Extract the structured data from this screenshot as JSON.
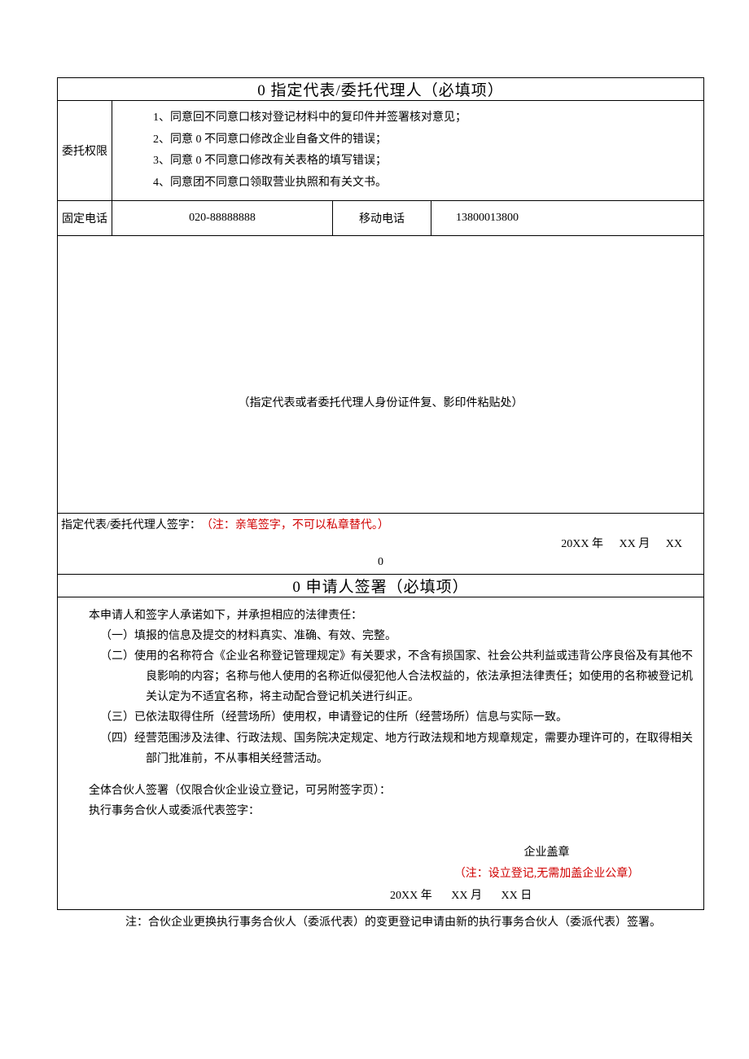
{
  "section1": {
    "title": "0 指定代表/委托代理人（必填项）",
    "auth_label": "委托权限",
    "auth_items": [
      "1、同意回不同意口核对登记材料中的复印件并签署核对意见；",
      "2、同意 0 不同意口修改企业自备文件的错误；",
      "3、同意 0 不同意口修改有关表格的填写错误；",
      "4、同意团不同意口领取营业执照和有关文书。"
    ],
    "fixed_phone_label": "固定电话",
    "fixed_phone_value": "020-88888888",
    "mobile_phone_label": "移动电话",
    "mobile_phone_value": "13800013800",
    "id_placeholder": "（指定代表或者委托代理人身份证件复、影印件粘贴处）",
    "sign_label": "指定代表/委托代理人签字：",
    "sign_note": "（注：亲笔签字，不可以私章替代。）",
    "date": {
      "year": "20XX 年",
      "month": "XX 月",
      "day": "XX"
    },
    "zero": "0"
  },
  "section2": {
    "title": "0 申请人签署（必填项）",
    "intro": "本申请人和签字人承诺如下，并承担相应的法律责任：",
    "items": [
      "（一）填报的信息及提交的材料真实、准确、有效、完整。",
      "（二）使用的名称符合《企业名称登记管理规定》有关要求，不含有损国家、社会公共利益或违背公序良俗及有其他不良影响的内容；名称与他人使用的名称近似侵犯他人合法权益的，依法承担法律责任；如使用的名称被登记机关认定为不适宜名称，将主动配合登记机关进行纠正。",
      "（三）已依法取得住所（经营场所）使用权，申请登记的住所（经营场所）信息与实际一致。",
      "（四）经营范围涉及法律、行政法规、国务院决定规定、地方行政法规和地方规章规定，需要办理许可的，在取得相关部门批准前，不从事相关经营活动。"
    ],
    "sign1": "全体合伙人签署（仅限合伙企业设立登记，可另附签字页）：",
    "sign2": "执行事务合伙人或委派代表签字：",
    "stamp_label": "企业盖章",
    "stamp_note": "（注：设立登记,无需加盖企业公章）",
    "date": {
      "year": "20XX 年",
      "month": "XX 月",
      "day": "XX 日"
    }
  },
  "footnote": "注：合伙企业更换执行事务合伙人（委派代表）的变更登记申请由新的执行事务合伙人（委派代表）签署。"
}
